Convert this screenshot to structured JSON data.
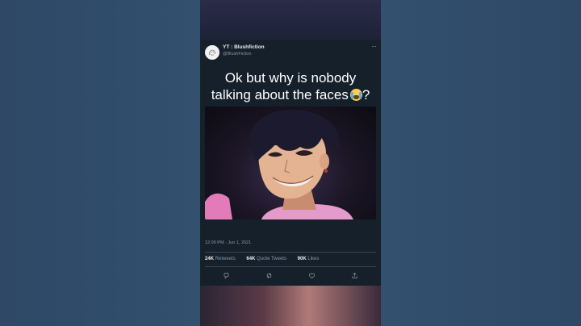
{
  "tweet": {
    "display_name": "YT : Blushfiction",
    "handle": "@BlushFiction",
    "more_glyph": "···",
    "headline_line1": "Ok but why is nobody",
    "headline_line2": "talking about the faces",
    "headline_end": "?",
    "emoji": "loudly-crying-face",
    "timestamp": "12:00 PM · Jun 1, 2021",
    "stats": {
      "retweets_count": "24K",
      "retweets_label": "Retweets",
      "quotes_count": "64K",
      "quotes_label": "Quote Tweets",
      "likes_count": "90K",
      "likes_label": "Likes"
    },
    "actions": [
      "reply-icon",
      "retweet-icon",
      "like-icon",
      "share-icon"
    ]
  },
  "colors": {
    "tweet_bg": "#15202b",
    "side_bg": "#2f4a68",
    "text_primary": "#e8eaed",
    "text_secondary": "#8899a6"
  }
}
